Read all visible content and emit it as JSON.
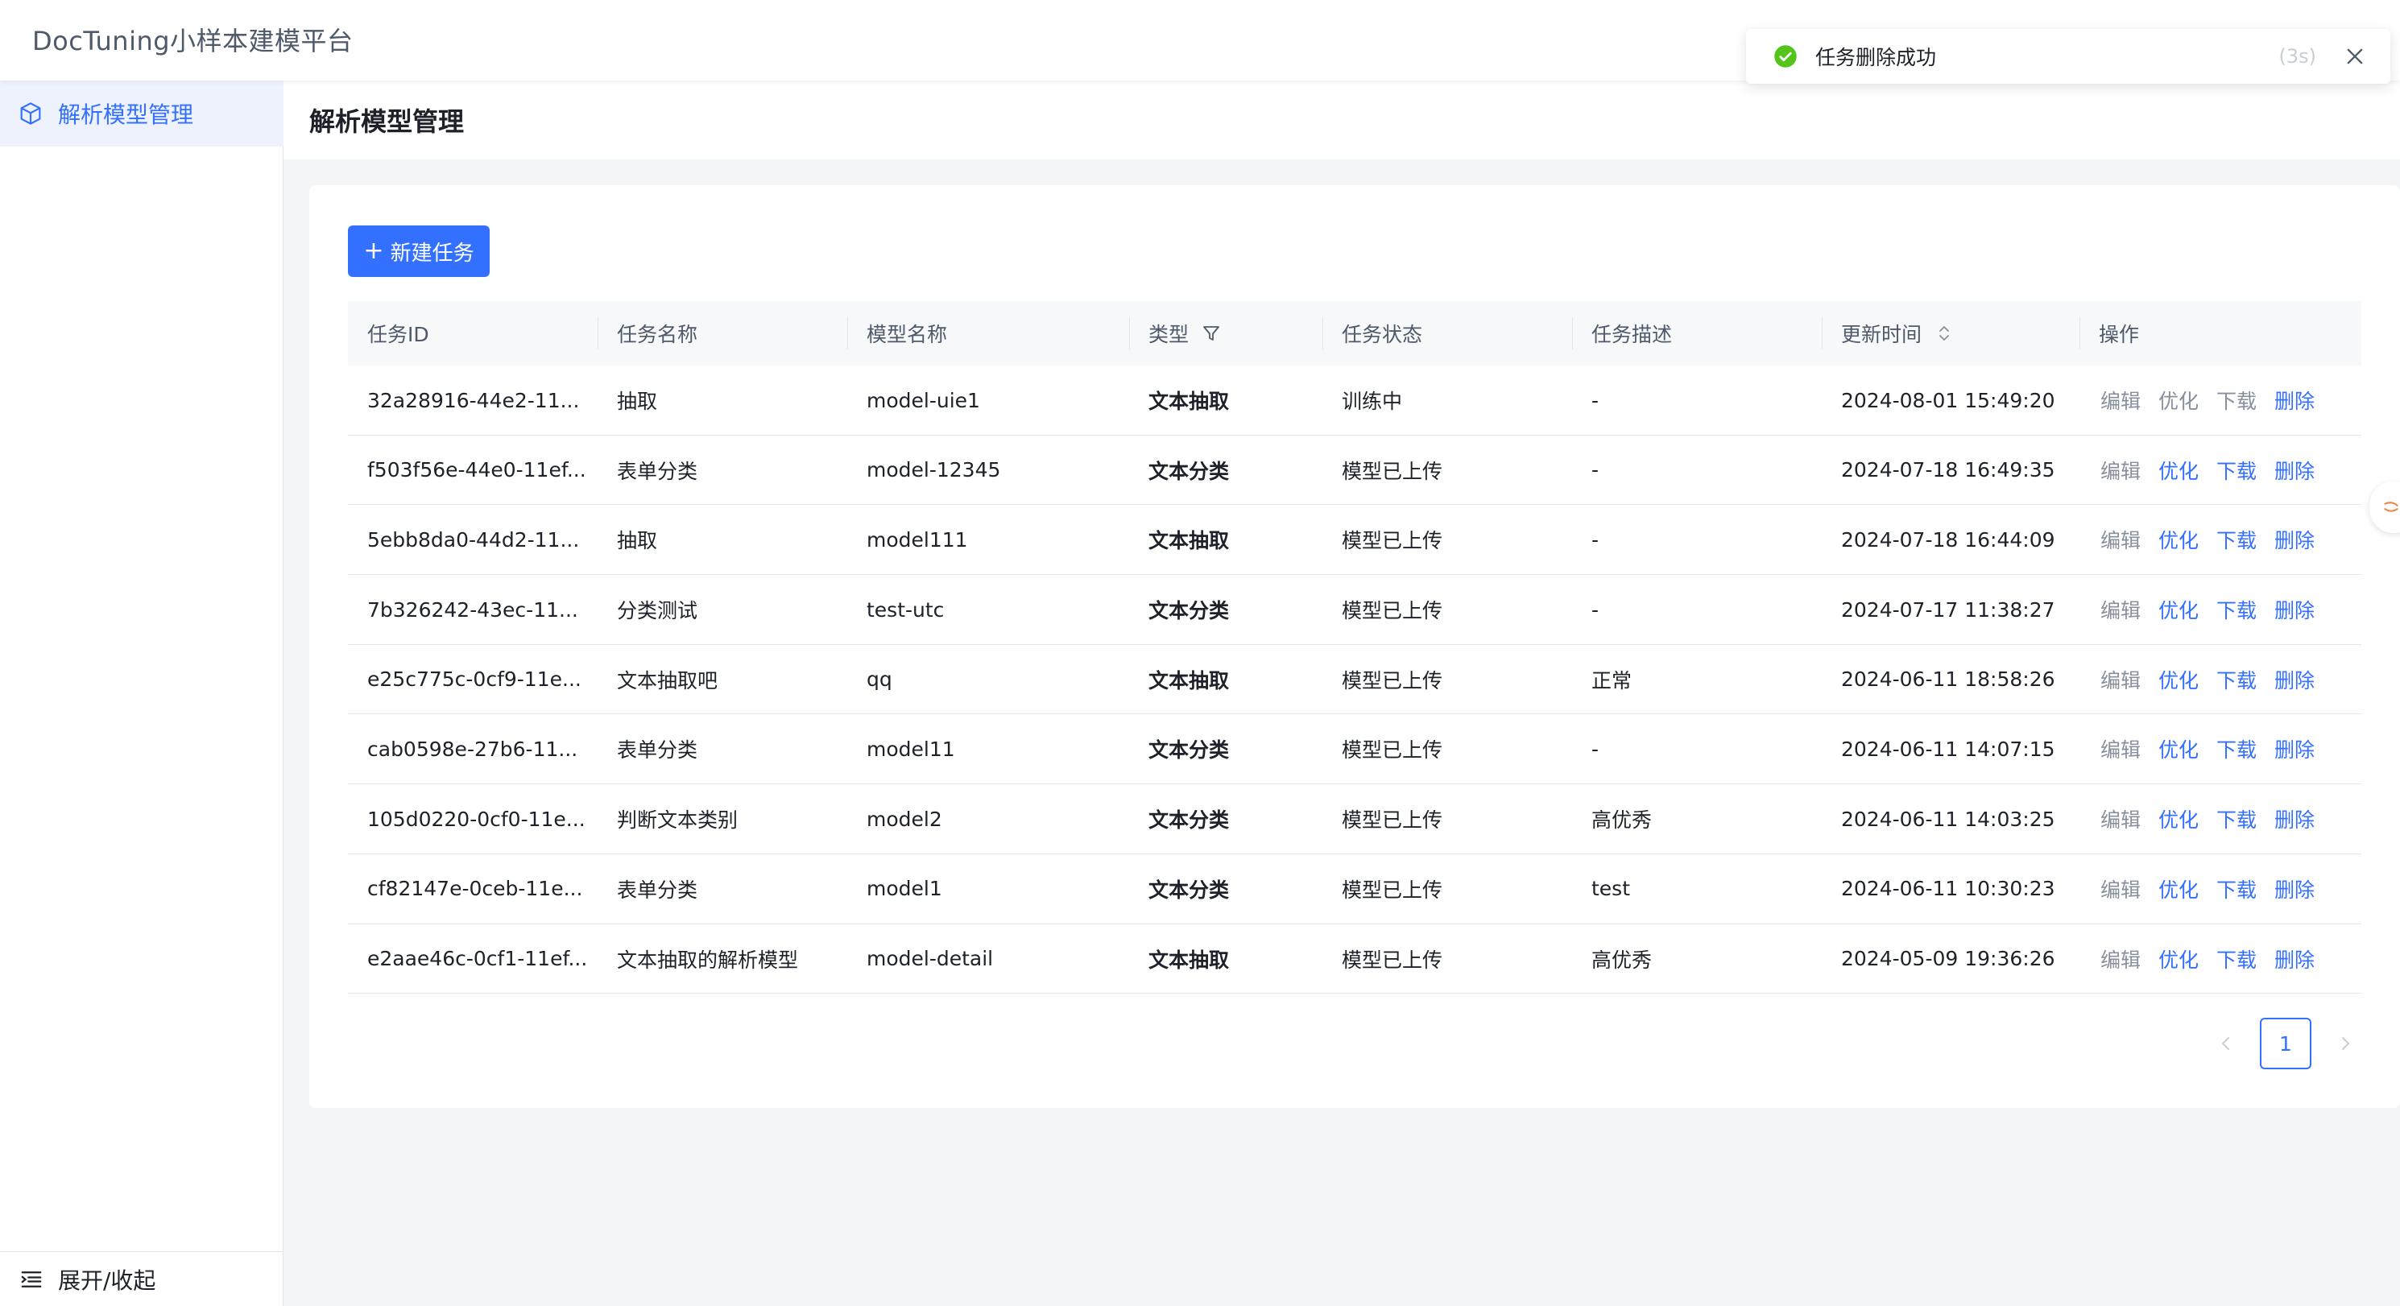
{
  "app": {
    "title": "DocTuning小样本建模平台"
  },
  "sidebar": {
    "items": [
      {
        "label": "解析模型管理",
        "icon": "cube-icon"
      }
    ],
    "collapse_label": "展开/收起"
  },
  "page": {
    "title": "解析模型管理"
  },
  "toolbar": {
    "new_task_label": "新建任务"
  },
  "table": {
    "columns": [
      "任务ID",
      "任务名称",
      "模型名称",
      "类型",
      "任务状态",
      "任务描述",
      "更新时间",
      "操作"
    ],
    "rows": [
      {
        "id": "32a28916-44e2-11...",
        "name": "抽取",
        "model": "model-uie1",
        "type": "文本抽取",
        "status": "训练中",
        "desc": "-",
        "updated": "2024-08-01 15:49:20",
        "ops_enabled": false
      },
      {
        "id": "f503f56e-44e0-11ef...",
        "name": "表单分类",
        "model": "model-12345",
        "type": "文本分类",
        "status": "模型已上传",
        "desc": "-",
        "updated": "2024-07-18 16:49:35",
        "ops_enabled": true
      },
      {
        "id": "5ebb8da0-44d2-11...",
        "name": "抽取",
        "model": "model111",
        "type": "文本抽取",
        "status": "模型已上传",
        "desc": "-",
        "updated": "2024-07-18 16:44:09",
        "ops_enabled": true
      },
      {
        "id": "7b326242-43ec-11...",
        "name": "分类测试",
        "model": "test-utc",
        "type": "文本分类",
        "status": "模型已上传",
        "desc": "-",
        "updated": "2024-07-17 11:38:27",
        "ops_enabled": true
      },
      {
        "id": "e25c775c-0cf9-11e...",
        "name": "文本抽取吧",
        "model": "qq",
        "type": "文本抽取",
        "status": "模型已上传",
        "desc": "正常",
        "updated": "2024-06-11 18:58:26",
        "ops_enabled": true
      },
      {
        "id": "cab0598e-27b6-11...",
        "name": "表单分类",
        "model": "model11",
        "type": "文本分类",
        "status": "模型已上传",
        "desc": "-",
        "updated": "2024-06-11 14:07:15",
        "ops_enabled": true
      },
      {
        "id": "105d0220-0cf0-11e...",
        "name": "判断文本类别",
        "model": "model2",
        "type": "文本分类",
        "status": "模型已上传",
        "desc": "高优秀",
        "updated": "2024-06-11 14:03:25",
        "ops_enabled": true
      },
      {
        "id": "cf82147e-0ceb-11e...",
        "name": "表单分类",
        "model": "model1",
        "type": "文本分类",
        "status": "模型已上传",
        "desc": "test",
        "updated": "2024-06-11 10:30:23",
        "ops_enabled": true
      },
      {
        "id": "e2aae46c-0cf1-11ef...",
        "name": "文本抽取的解析模型",
        "model": "model-detail",
        "type": "文本抽取",
        "status": "模型已上传",
        "desc": "高优秀",
        "updated": "2024-05-09 19:36:26",
        "ops_enabled": true
      }
    ],
    "actions": {
      "edit": "编辑",
      "optimize": "优化",
      "download": "下载",
      "delete": "删除"
    }
  },
  "pagination": {
    "current_page": "1"
  },
  "toast": {
    "message": "任务删除成功",
    "countdown": "(3s)"
  },
  "colors": {
    "accent": "#3370ff",
    "success": "#52c41a",
    "muted": "#86909c"
  }
}
